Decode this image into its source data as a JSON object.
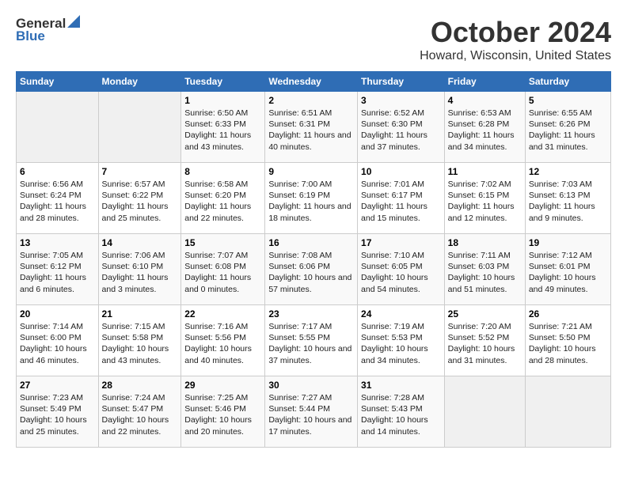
{
  "header": {
    "logo_general": "General",
    "logo_blue": "Blue",
    "title": "October 2024",
    "subtitle": "Howard, Wisconsin, United States"
  },
  "calendar": {
    "days_of_week": [
      "Sunday",
      "Monday",
      "Tuesday",
      "Wednesday",
      "Thursday",
      "Friday",
      "Saturday"
    ],
    "weeks": [
      [
        {
          "day": "",
          "empty": true
        },
        {
          "day": "",
          "empty": true
        },
        {
          "day": "1",
          "sunrise": "Sunrise: 6:50 AM",
          "sunset": "Sunset: 6:33 PM",
          "daylight": "Daylight: 11 hours and 43 minutes."
        },
        {
          "day": "2",
          "sunrise": "Sunrise: 6:51 AM",
          "sunset": "Sunset: 6:31 PM",
          "daylight": "Daylight: 11 hours and 40 minutes."
        },
        {
          "day": "3",
          "sunrise": "Sunrise: 6:52 AM",
          "sunset": "Sunset: 6:30 PM",
          "daylight": "Daylight: 11 hours and 37 minutes."
        },
        {
          "day": "4",
          "sunrise": "Sunrise: 6:53 AM",
          "sunset": "Sunset: 6:28 PM",
          "daylight": "Daylight: 11 hours and 34 minutes."
        },
        {
          "day": "5",
          "sunrise": "Sunrise: 6:55 AM",
          "sunset": "Sunset: 6:26 PM",
          "daylight": "Daylight: 11 hours and 31 minutes."
        }
      ],
      [
        {
          "day": "6",
          "sunrise": "Sunrise: 6:56 AM",
          "sunset": "Sunset: 6:24 PM",
          "daylight": "Daylight: 11 hours and 28 minutes."
        },
        {
          "day": "7",
          "sunrise": "Sunrise: 6:57 AM",
          "sunset": "Sunset: 6:22 PM",
          "daylight": "Daylight: 11 hours and 25 minutes."
        },
        {
          "day": "8",
          "sunrise": "Sunrise: 6:58 AM",
          "sunset": "Sunset: 6:20 PM",
          "daylight": "Daylight: 11 hours and 22 minutes."
        },
        {
          "day": "9",
          "sunrise": "Sunrise: 7:00 AM",
          "sunset": "Sunset: 6:19 PM",
          "daylight": "Daylight: 11 hours and 18 minutes."
        },
        {
          "day": "10",
          "sunrise": "Sunrise: 7:01 AM",
          "sunset": "Sunset: 6:17 PM",
          "daylight": "Daylight: 11 hours and 15 minutes."
        },
        {
          "day": "11",
          "sunrise": "Sunrise: 7:02 AM",
          "sunset": "Sunset: 6:15 PM",
          "daylight": "Daylight: 11 hours and 12 minutes."
        },
        {
          "day": "12",
          "sunrise": "Sunrise: 7:03 AM",
          "sunset": "Sunset: 6:13 PM",
          "daylight": "Daylight: 11 hours and 9 minutes."
        }
      ],
      [
        {
          "day": "13",
          "sunrise": "Sunrise: 7:05 AM",
          "sunset": "Sunset: 6:12 PM",
          "daylight": "Daylight: 11 hours and 6 minutes."
        },
        {
          "day": "14",
          "sunrise": "Sunrise: 7:06 AM",
          "sunset": "Sunset: 6:10 PM",
          "daylight": "Daylight: 11 hours and 3 minutes."
        },
        {
          "day": "15",
          "sunrise": "Sunrise: 7:07 AM",
          "sunset": "Sunset: 6:08 PM",
          "daylight": "Daylight: 11 hours and 0 minutes."
        },
        {
          "day": "16",
          "sunrise": "Sunrise: 7:08 AM",
          "sunset": "Sunset: 6:06 PM",
          "daylight": "Daylight: 10 hours and 57 minutes."
        },
        {
          "day": "17",
          "sunrise": "Sunrise: 7:10 AM",
          "sunset": "Sunset: 6:05 PM",
          "daylight": "Daylight: 10 hours and 54 minutes."
        },
        {
          "day": "18",
          "sunrise": "Sunrise: 7:11 AM",
          "sunset": "Sunset: 6:03 PM",
          "daylight": "Daylight: 10 hours and 51 minutes."
        },
        {
          "day": "19",
          "sunrise": "Sunrise: 7:12 AM",
          "sunset": "Sunset: 6:01 PM",
          "daylight": "Daylight: 10 hours and 49 minutes."
        }
      ],
      [
        {
          "day": "20",
          "sunrise": "Sunrise: 7:14 AM",
          "sunset": "Sunset: 6:00 PM",
          "daylight": "Daylight: 10 hours and 46 minutes."
        },
        {
          "day": "21",
          "sunrise": "Sunrise: 7:15 AM",
          "sunset": "Sunset: 5:58 PM",
          "daylight": "Daylight: 10 hours and 43 minutes."
        },
        {
          "day": "22",
          "sunrise": "Sunrise: 7:16 AM",
          "sunset": "Sunset: 5:56 PM",
          "daylight": "Daylight: 10 hours and 40 minutes."
        },
        {
          "day": "23",
          "sunrise": "Sunrise: 7:17 AM",
          "sunset": "Sunset: 5:55 PM",
          "daylight": "Daylight: 10 hours and 37 minutes."
        },
        {
          "day": "24",
          "sunrise": "Sunrise: 7:19 AM",
          "sunset": "Sunset: 5:53 PM",
          "daylight": "Daylight: 10 hours and 34 minutes."
        },
        {
          "day": "25",
          "sunrise": "Sunrise: 7:20 AM",
          "sunset": "Sunset: 5:52 PM",
          "daylight": "Daylight: 10 hours and 31 minutes."
        },
        {
          "day": "26",
          "sunrise": "Sunrise: 7:21 AM",
          "sunset": "Sunset: 5:50 PM",
          "daylight": "Daylight: 10 hours and 28 minutes."
        }
      ],
      [
        {
          "day": "27",
          "sunrise": "Sunrise: 7:23 AM",
          "sunset": "Sunset: 5:49 PM",
          "daylight": "Daylight: 10 hours and 25 minutes."
        },
        {
          "day": "28",
          "sunrise": "Sunrise: 7:24 AM",
          "sunset": "Sunset: 5:47 PM",
          "daylight": "Daylight: 10 hours and 22 minutes."
        },
        {
          "day": "29",
          "sunrise": "Sunrise: 7:25 AM",
          "sunset": "Sunset: 5:46 PM",
          "daylight": "Daylight: 10 hours and 20 minutes."
        },
        {
          "day": "30",
          "sunrise": "Sunrise: 7:27 AM",
          "sunset": "Sunset: 5:44 PM",
          "daylight": "Daylight: 10 hours and 17 minutes."
        },
        {
          "day": "31",
          "sunrise": "Sunrise: 7:28 AM",
          "sunset": "Sunset: 5:43 PM",
          "daylight": "Daylight: 10 hours and 14 minutes."
        },
        {
          "day": "",
          "empty": true
        },
        {
          "day": "",
          "empty": true
        }
      ]
    ]
  }
}
